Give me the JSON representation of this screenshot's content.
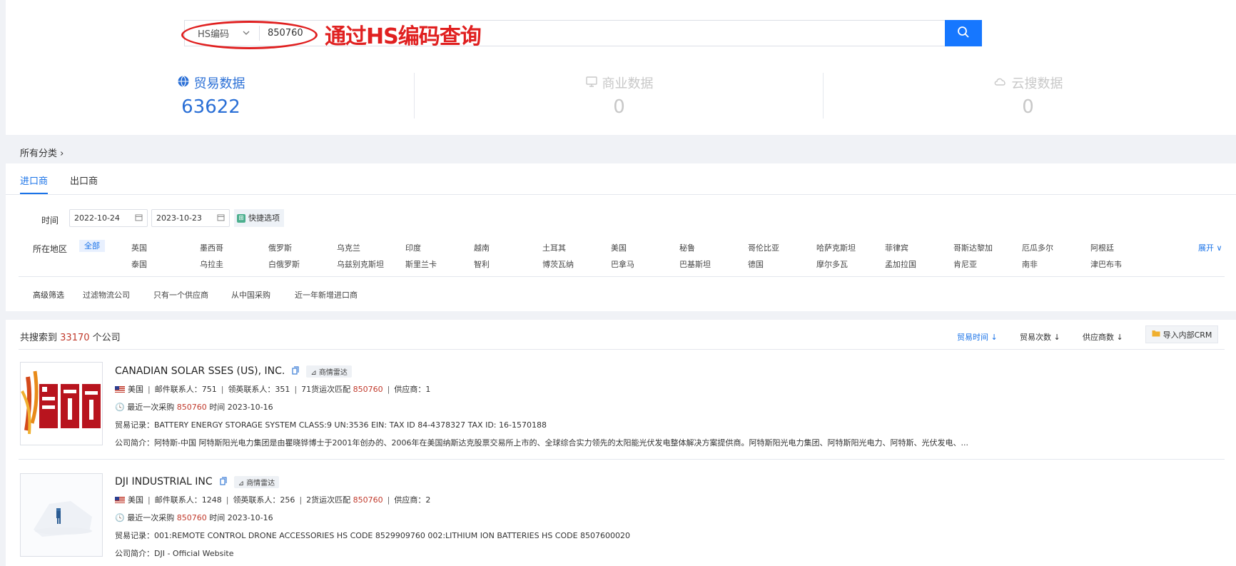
{
  "search": {
    "type_label": "HS编码",
    "value": "850760",
    "annotation": "通过HS编码查询"
  },
  "stats": [
    {
      "label": "贸易数据",
      "value": "63622",
      "icon": "globe-icon"
    },
    {
      "label": "商业数据",
      "value": "0",
      "icon": "monitor-icon"
    },
    {
      "label": "云搜数据",
      "value": "0",
      "icon": "cloud-icon"
    }
  ],
  "breadcrumb": "所有分类 ›",
  "tabs": {
    "import": "进口商",
    "export": "出口商"
  },
  "filters": {
    "time_label": "时间",
    "date_start": "2022-10-24",
    "date_end": "2023-10-23",
    "quick_options": "快捷选项",
    "region_label": "所在地区",
    "region_all": "全部",
    "regions_row1": [
      "英国",
      "墨西哥",
      "俄罗斯",
      "乌克兰",
      "印度",
      "越南",
      "土耳其",
      "美国",
      "秘鲁",
      "哥伦比亚",
      "哈萨克斯坦",
      "菲律宾",
      "哥斯达黎加",
      "厄瓜多尔",
      "阿根廷"
    ],
    "regions_row2": [
      "泰国",
      "乌拉圭",
      "白俄罗斯",
      "乌兹别克斯坦",
      "斯里兰卡",
      "智利",
      "博茨瓦纳",
      "巴拿马",
      "巴基斯坦",
      "德国",
      "摩尔多瓦",
      "孟加拉国",
      "肯尼亚",
      "南非",
      "津巴布韦"
    ],
    "expand": "展开 ∨",
    "advanced_label": "高级筛选",
    "advanced_options": [
      "过滤物流公司",
      "只有一个供应商",
      "从中国采购",
      "近一年新增进口商"
    ]
  },
  "results": {
    "prefix": "共搜索到",
    "count": "33170",
    "suffix": "个公司",
    "sort_trade_time": "贸易时间 ↓",
    "sort_trade_count": "贸易次数 ↓",
    "sort_suppliers": "供应商数 ↓",
    "crm_button": "导入内部CRM",
    "companies": [
      {
        "name": "CANADIAN SOLAR SSES (US), INC.",
        "badge": "商情雷达",
        "country": "美国",
        "email_contacts": "邮件联系人：751",
        "linkedin_contacts": "领英联系人：351",
        "match_prefix": "71货运次匹配",
        "match_code": "850760",
        "suppliers": "供应商：1",
        "recent_prefix": "最近一次采购",
        "recent_code": "850760",
        "recent_suffix": "时间 2023-10-16",
        "trade_record": "贸易记录：BATTERY ENERGY STORAGE SYSTEM CLASS:9 UN:3536 EIN: TAX ID 84-4378327 TAX ID: 16-1570188",
        "intro": "公司简介：阿特斯-中国 阿特斯阳光电力集团是由瞿晓铧博士于2001年创办的、2006年在美国纳斯达克股票交易所上市的、全球综合实力领先的太阳能光伏发电整体解决方案提供商。阿特斯阳光电力集团、阿特斯阳光电力、阿特斯、光伏发电、..."
      },
      {
        "name": "DJI INDUSTRIAL INC",
        "badge": "商情雷达",
        "country": "美国",
        "email_contacts": "邮件联系人：1248",
        "linkedin_contacts": "领英联系人：256",
        "match_prefix": "2货运次匹配",
        "match_code": "850760",
        "suppliers": "供应商：2",
        "recent_prefix": "最近一次采购",
        "recent_code": "850760",
        "recent_suffix": "时间 2023-10-16",
        "trade_record": "贸易记录：001:REMOTE CONTROL DRONE ACCESSORIES HS CODE 8529909760 002:LITHIUM ION BATTERIES HS CODE 8507600020",
        "intro": "公司简介：DJI - Official Website"
      }
    ]
  },
  "colors": {
    "accent": "#1677ff",
    "annotation": "#e02020",
    "highlight": "#c0392b"
  }
}
